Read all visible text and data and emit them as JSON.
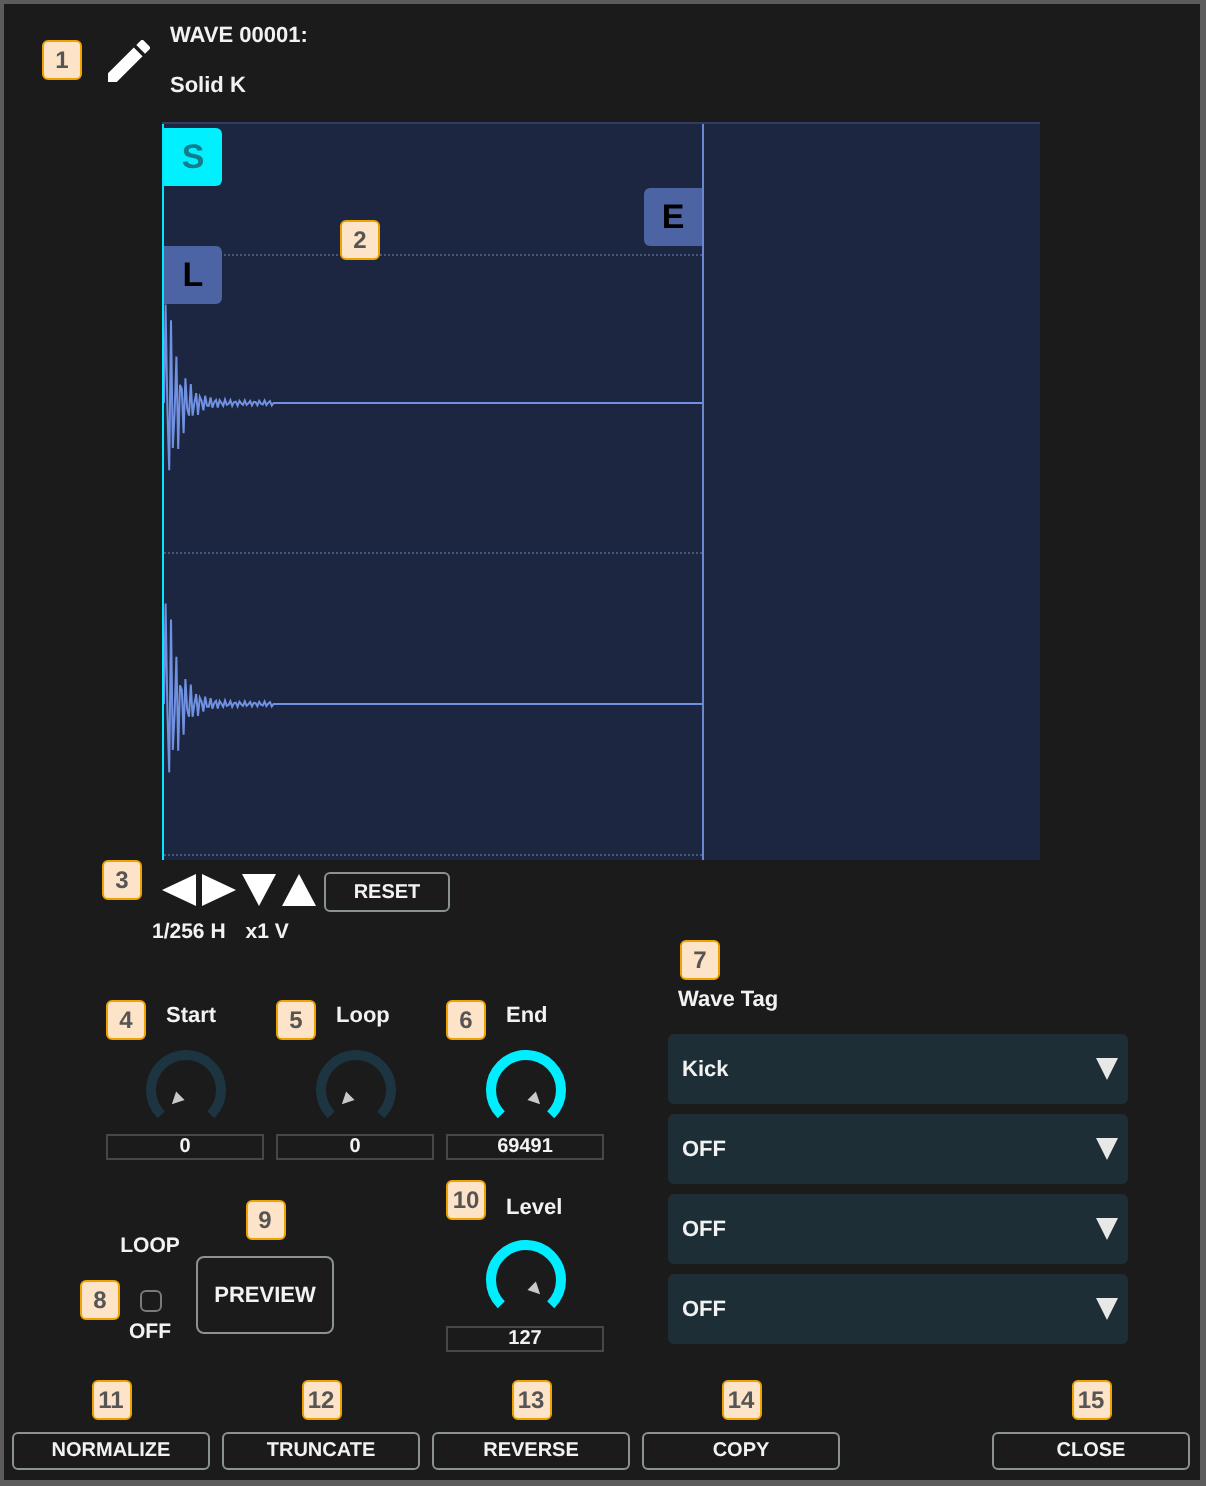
{
  "header": {
    "callout": "1",
    "wave_number": "WAVE 00001:",
    "wave_name": "Solid K"
  },
  "waveform": {
    "callout": "2",
    "markers": [
      {
        "kind": "start",
        "label": "S",
        "selected": true
      },
      {
        "kind": "end",
        "label": "E",
        "selected": false
      },
      {
        "kind": "loop",
        "label": "L",
        "selected": false
      }
    ]
  },
  "zoom": {
    "callout": "3",
    "reset": "RESET",
    "horizontal": "1/256 H",
    "vertical": "x1 V"
  },
  "points": [
    {
      "callout": "4",
      "label": "Start",
      "value": "0",
      "level": 0
    },
    {
      "callout": "5",
      "label": "Loop",
      "value": "0",
      "level": 0
    },
    {
      "callout": "6",
      "label": "End",
      "value": "69491",
      "level": 1
    }
  ],
  "wave_tag": {
    "callout": "7",
    "label": "Wave Tag",
    "slots": [
      {
        "value": "Kick"
      },
      {
        "value": "OFF"
      },
      {
        "value": "OFF"
      },
      {
        "value": "OFF"
      }
    ]
  },
  "loop": {
    "callout": "8",
    "label": "LOOP",
    "checked": false,
    "state": "OFF"
  },
  "preview": {
    "callout": "9",
    "label": "PREVIEW"
  },
  "level": {
    "callout": "10",
    "label": "Level",
    "value": "127",
    "level": 1
  },
  "buttons": [
    {
      "callout": "11",
      "label": "NORMALIZE"
    },
    {
      "callout": "12",
      "label": "TRUNCATE"
    },
    {
      "callout": "13",
      "label": "REVERSE"
    },
    {
      "callout": "14",
      "label": "COPY"
    },
    {
      "callout": "15",
      "label": "CLOSE"
    }
  ]
}
